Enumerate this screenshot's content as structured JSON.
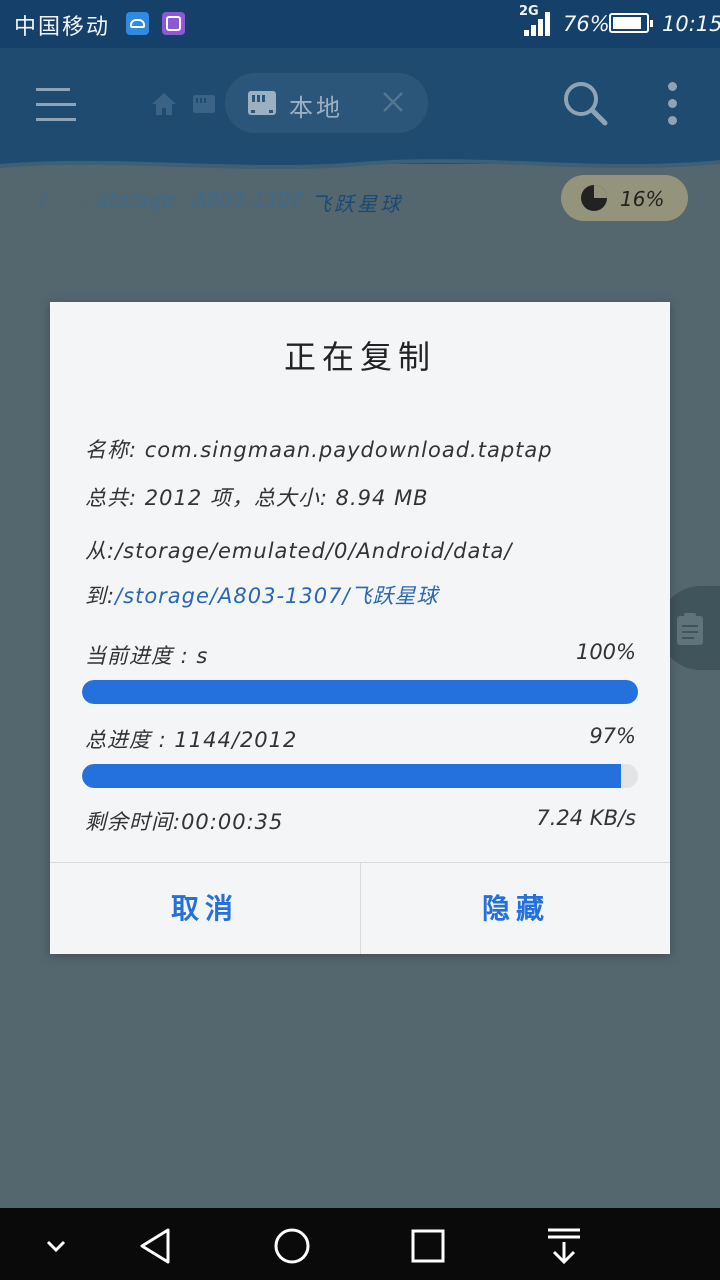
{
  "status_bar": {
    "carrier": "中国移动",
    "network": "2G",
    "battery_percent": "76%",
    "time": "10:15"
  },
  "toolbar": {
    "tab_label": "本地"
  },
  "breadcrumb": {
    "items": [
      "/",
      "storage",
      "A803-1307",
      "飞跃星球"
    ]
  },
  "storage_usage": "16%",
  "dialog": {
    "title": "正在复制",
    "name_label": "名称:",
    "name_value": "com.singmaan.paydownload.taptap",
    "total_label": "总共:",
    "total_value": "2012 项，总大小: 8.94 MB",
    "from_label": "从:",
    "from_value": "/storage/emulated/0/Android/data/",
    "to_label": "到:",
    "to_value": "/storage/A803-1307/飞跃星球",
    "current_progress_label": "当前进度 : s",
    "current_progress_pct": "100%",
    "current_progress_value": 1.0,
    "total_progress_label": "总进度 : 1144/2012",
    "total_progress_pct": "97%",
    "total_progress_value": 0.97,
    "remaining_label": "剩余时间:00:00:35",
    "speed": "7.24 KB/s",
    "cancel_label": "取消",
    "hide_label": "隐藏"
  },
  "colors": {
    "accent": "#2470dd",
    "toolbar": "#1f4b70",
    "overlay": "#54676e"
  }
}
